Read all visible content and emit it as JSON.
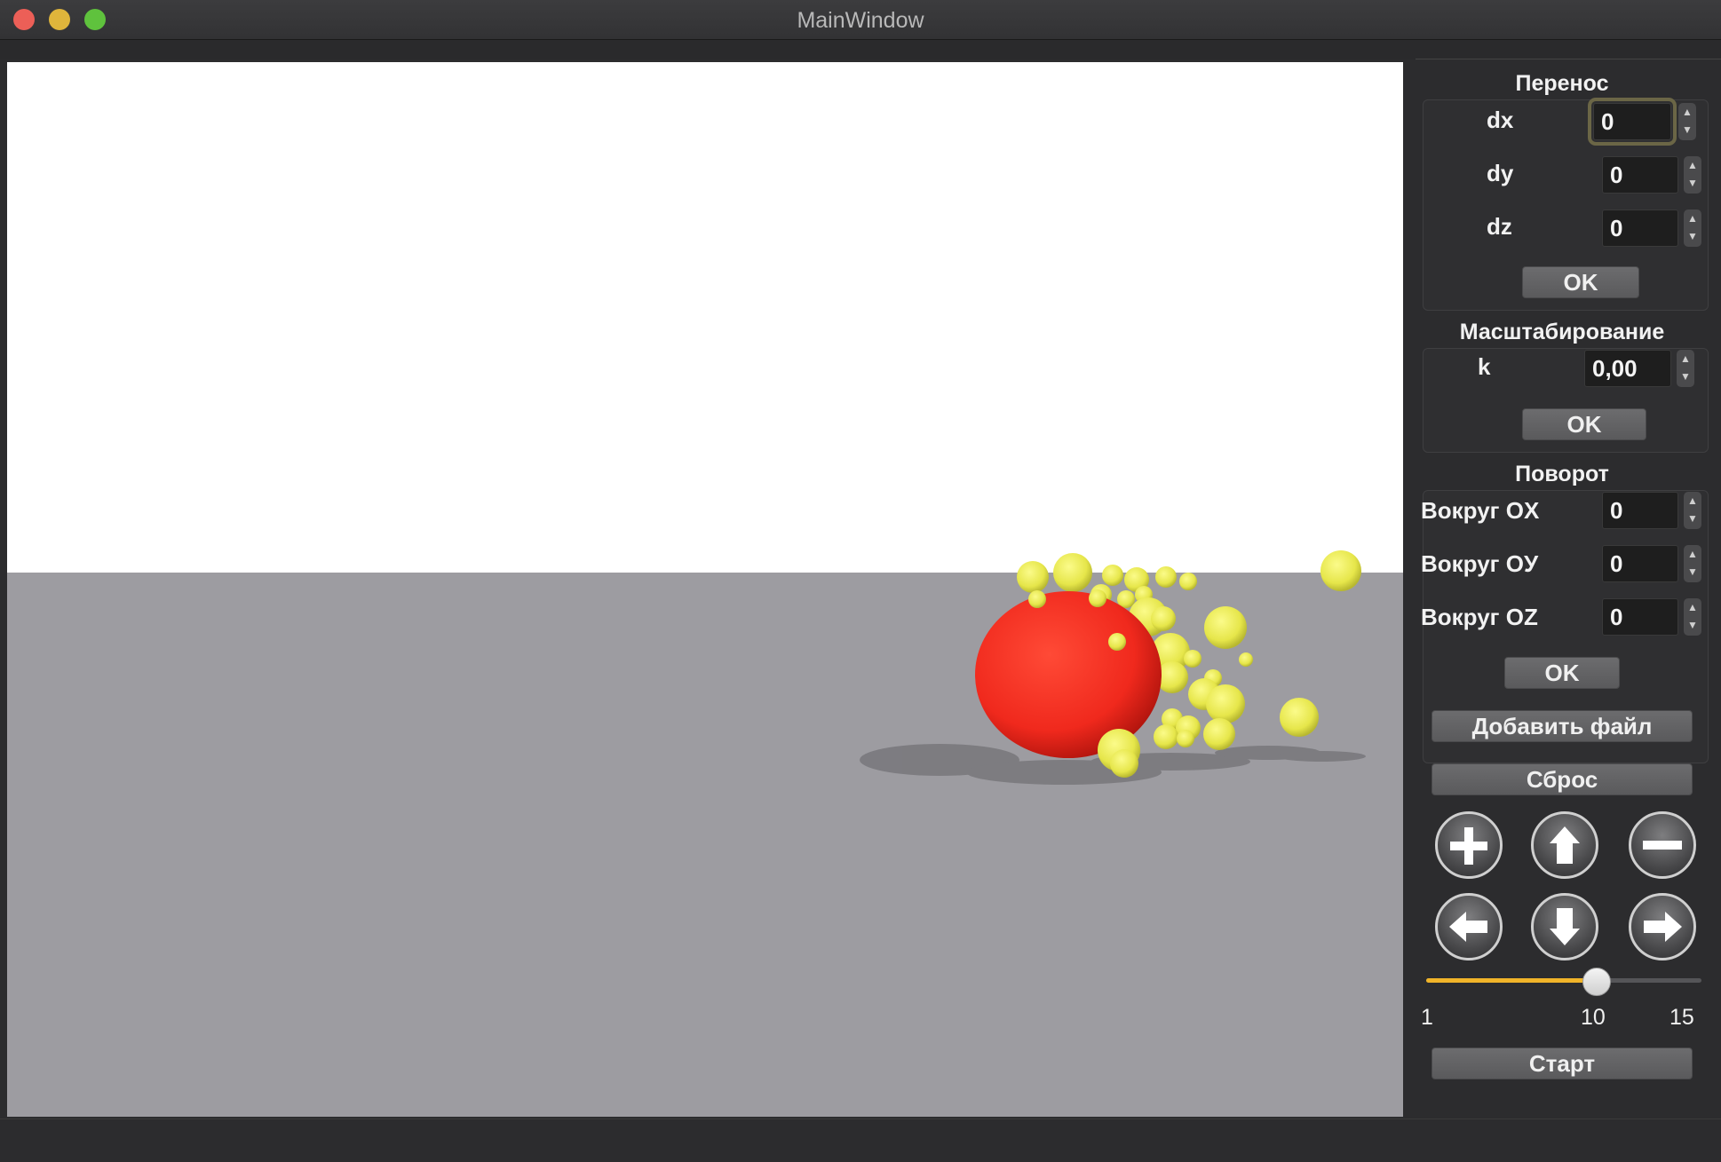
{
  "window": {
    "title": "MainWindow"
  },
  "colors": {
    "accent": "#f0b429",
    "ball": "#f33a2a",
    "particles": "#eded52",
    "floor": "#9d9ca1"
  },
  "translate": {
    "title": "Перенос",
    "dx_label": "dx",
    "dx_value": "0",
    "dy_label": "dy",
    "dy_value": "0",
    "dz_label": "dz",
    "dz_value": "0",
    "ok_label": "OK"
  },
  "scale": {
    "title": "Масштабирование",
    "k_label": "k",
    "k_value": "0,00",
    "ok_label": "OK"
  },
  "rotate": {
    "title": "Поворот",
    "ox_label": "Вокруг OX",
    "ox_value": "0",
    "oy_label": "Вокруг OУ",
    "oy_value": "0",
    "oz_label": "Вокруг OZ",
    "oz_value": "0",
    "ok_label": "OK"
  },
  "actions": {
    "add_file": "Добавить файл",
    "reset": "Сброс",
    "start": "Старт"
  },
  "controls": {
    "icons": [
      "plus-icon",
      "arrow-up-icon",
      "minus-icon",
      "arrow-left-icon",
      "arrow-down-icon",
      "arrow-right-icon"
    ]
  },
  "speed_slider": {
    "min_label": "1",
    "mid_label": "10",
    "max_label": "15",
    "value_fraction": 0.63
  }
}
